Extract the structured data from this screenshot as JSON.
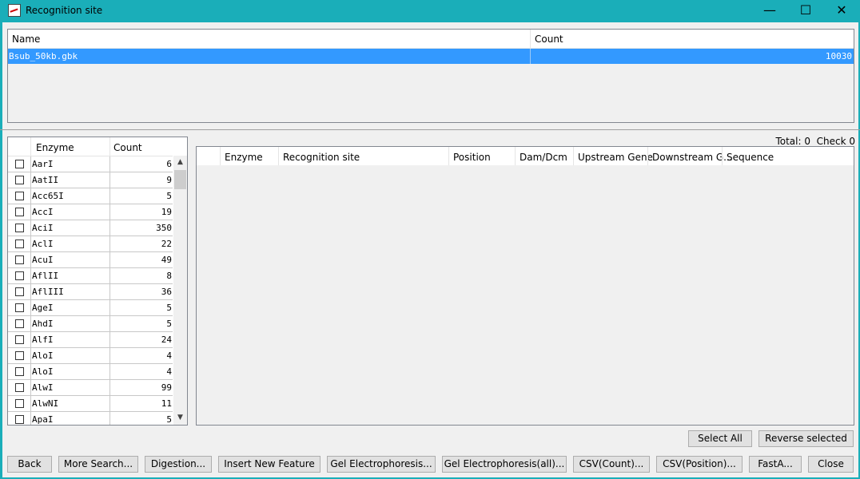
{
  "window": {
    "title": "Recognition site"
  },
  "file_table": {
    "columns": [
      "Name",
      "Count"
    ],
    "rows": [
      {
        "name": "Bsub_50kb.gbk",
        "count": "10030"
      }
    ]
  },
  "enzyme_list": {
    "columns": [
      "Enzyme",
      "Count"
    ],
    "rows": [
      {
        "name": "AarI",
        "count": "6"
      },
      {
        "name": "AatII",
        "count": "9"
      },
      {
        "name": "Acc65I",
        "count": "5"
      },
      {
        "name": "AccI",
        "count": "19"
      },
      {
        "name": "AciI",
        "count": "350"
      },
      {
        "name": "AclI",
        "count": "22"
      },
      {
        "name": "AcuI",
        "count": "49"
      },
      {
        "name": "AflII",
        "count": "8"
      },
      {
        "name": "AflIII",
        "count": "36"
      },
      {
        "name": "AgeI",
        "count": "5"
      },
      {
        "name": "AhdI",
        "count": "5"
      },
      {
        "name": "AlfI",
        "count": "24"
      },
      {
        "name": "AloI",
        "count": "4"
      },
      {
        "name": "AloI",
        "count": "4"
      },
      {
        "name": "AlwI",
        "count": "99"
      },
      {
        "name": "AlwNI",
        "count": "11"
      },
      {
        "name": "ApaI",
        "count": "5"
      }
    ]
  },
  "totals": {
    "total_label": "Total: 0",
    "check_label": "Check 0"
  },
  "result_table": {
    "columns": [
      "Enzyme",
      "Recognition site",
      "Position",
      "Dam/Dcm",
      "Upstream Gene",
      "Downstream G...",
      "Sequence"
    ]
  },
  "selection_buttons": {
    "select_all": "Select All",
    "reverse_selected": "Reverse selected"
  },
  "bottom_buttons": {
    "back": "Back",
    "more_search": "More Search...",
    "digestion": "Digestion...",
    "insert_new_feature": "Insert New Feature",
    "gel_electrophoresis": "Gel Electrophoresis...",
    "gel_electrophoresis_all": "Gel Electrophoresis(all)...",
    "csv_count": "CSV(Count)...",
    "csv_position": "CSV(Position)...",
    "fasta": "FastA...",
    "close": "Close"
  },
  "colors": {
    "titlebar": "#1aaeb9",
    "selection": "#3399ff"
  }
}
